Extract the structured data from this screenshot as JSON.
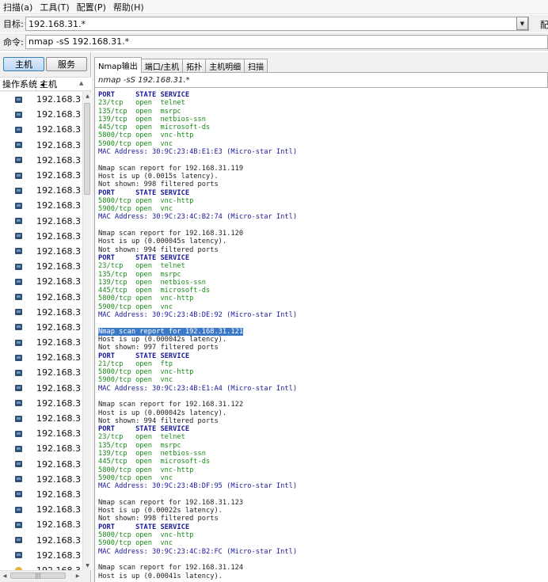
{
  "menu": [
    "扫描(a)",
    "工具(T)",
    "配置(P)",
    "帮助(H)"
  ],
  "target": {
    "label": "目标:",
    "value": "192.168.31.*",
    "profile_label": "配"
  },
  "command": {
    "label": "命令:",
    "value": "nmap -sS 192.168.31.*"
  },
  "left_panel": {
    "hosts_button": "主机",
    "services_button": "服务",
    "col_os": "操作系统 ◂",
    "col_host": "主机",
    "hosts": [
      {
        "ip": "192.168.3",
        "os": "windows"
      },
      {
        "ip": "192.168.3",
        "os": "windows"
      },
      {
        "ip": "192.168.3",
        "os": "windows"
      },
      {
        "ip": "192.168.3",
        "os": "windows"
      },
      {
        "ip": "192.168.3",
        "os": "windows"
      },
      {
        "ip": "192.168.3",
        "os": "windows"
      },
      {
        "ip": "192.168.3",
        "os": "windows"
      },
      {
        "ip": "192.168.3",
        "os": "windows"
      },
      {
        "ip": "192.168.3",
        "os": "windows"
      },
      {
        "ip": "192.168.3",
        "os": "windows"
      },
      {
        "ip": "192.168.3",
        "os": "windows"
      },
      {
        "ip": "192.168.3",
        "os": "windows"
      },
      {
        "ip": "192.168.3",
        "os": "windows"
      },
      {
        "ip": "192.168.3",
        "os": "windows"
      },
      {
        "ip": "192.168.3",
        "os": "windows"
      },
      {
        "ip": "192.168.3",
        "os": "windows"
      },
      {
        "ip": "192.168.3",
        "os": "windows"
      },
      {
        "ip": "192.168.3",
        "os": "windows"
      },
      {
        "ip": "192.168.3",
        "os": "windows"
      },
      {
        "ip": "192.168.3",
        "os": "windows"
      },
      {
        "ip": "192.168.3",
        "os": "windows"
      },
      {
        "ip": "192.168.3",
        "os": "windows"
      },
      {
        "ip": "192.168.3",
        "os": "windows"
      },
      {
        "ip": "192.168.3",
        "os": "windows"
      },
      {
        "ip": "192.168.3",
        "os": "windows"
      },
      {
        "ip": "192.168.3",
        "os": "windows"
      },
      {
        "ip": "192.168.3",
        "os": "windows"
      },
      {
        "ip": "192.168.3",
        "os": "windows"
      },
      {
        "ip": "192.168.3",
        "os": "windows"
      },
      {
        "ip": "192.168.3",
        "os": "windows"
      },
      {
        "ip": "192.168.3",
        "os": "windows"
      },
      {
        "ip": "192.168.3",
        "os": "linux"
      },
      {
        "ip": "192.168.3",
        "os": "windows"
      }
    ]
  },
  "tabs": [
    "Nmap输出",
    "端口/主机",
    "拓扑",
    "主机明细",
    "扫描"
  ],
  "output_command": "nmap -sS 192.168.31.*",
  "output": [
    {
      "t": "PORT     STATE SERVICE",
      "c": "hdr"
    },
    {
      "t": "23/tcp   open  telnet",
      "c": "open"
    },
    {
      "t": "135/tcp  open  msrpc",
      "c": "open"
    },
    {
      "t": "139/tcp  open  netbios-ssn",
      "c": "open"
    },
    {
      "t": "445/tcp  open  microsoft-ds",
      "c": "open"
    },
    {
      "t": "5800/tcp open  vnc-http",
      "c": "open"
    },
    {
      "t": "5900/tcp open  vnc",
      "c": "open"
    },
    {
      "t": "MAC Address: 30:9C:23:4B:E1:E3 (Micro-star Intl)",
      "c": "mac"
    },
    {
      "t": "",
      "c": "blank"
    },
    {
      "t": "Nmap scan report for 192.168.31.119",
      "c": "plain"
    },
    {
      "t": "Host is up (0.0015s latency).",
      "c": "plain"
    },
    {
      "t": "Not shown: 998 filtered ports",
      "c": "plain"
    },
    {
      "t": "PORT     STATE SERVICE",
      "c": "hdr"
    },
    {
      "t": "5800/tcp open  vnc-http",
      "c": "open"
    },
    {
      "t": "5900/tcp open  vnc",
      "c": "open"
    },
    {
      "t": "MAC Address: 30:9C:23:4C:B2:74 (Micro-star Intl)",
      "c": "mac"
    },
    {
      "t": "",
      "c": "blank"
    },
    {
      "t": "Nmap scan report for 192.168.31.120",
      "c": "plain"
    },
    {
      "t": "Host is up (0.000045s latency).",
      "c": "plain"
    },
    {
      "t": "Not shown: 994 filtered ports",
      "c": "plain"
    },
    {
      "t": "PORT     STATE SERVICE",
      "c": "hdr"
    },
    {
      "t": "23/tcp   open  telnet",
      "c": "open"
    },
    {
      "t": "135/tcp  open  msrpc",
      "c": "open"
    },
    {
      "t": "139/tcp  open  netbios-ssn",
      "c": "open"
    },
    {
      "t": "445/tcp  open  microsoft-ds",
      "c": "open"
    },
    {
      "t": "5800/tcp open  vnc-http",
      "c": "open"
    },
    {
      "t": "5900/tcp open  vnc",
      "c": "open"
    },
    {
      "t": "MAC Address: 30:9C:23:4B:DE:92 (Micro-star Intl)",
      "c": "mac"
    },
    {
      "t": "",
      "c": "blank"
    },
    {
      "t": "Nmap scan report for 192.168.31.121",
      "c": "hl"
    },
    {
      "t": "Host is up (0.000042s latency).",
      "c": "plain"
    },
    {
      "t": "Not shown: 997 filtered ports",
      "c": "plain"
    },
    {
      "t": "PORT     STATE SERVICE",
      "c": "hdr"
    },
    {
      "t": "21/tcp   open  ftp",
      "c": "open"
    },
    {
      "t": "5800/tcp open  vnc-http",
      "c": "open"
    },
    {
      "t": "5900/tcp open  vnc",
      "c": "open"
    },
    {
      "t": "MAC Address: 30:9C:23:4B:E1:A4 (Micro-star Intl)",
      "c": "mac"
    },
    {
      "t": "",
      "c": "blank"
    },
    {
      "t": "Nmap scan report for 192.168.31.122",
      "c": "plain"
    },
    {
      "t": "Host is up (0.000042s latency).",
      "c": "plain"
    },
    {
      "t": "Not shown: 994 filtered ports",
      "c": "plain"
    },
    {
      "t": "PORT     STATE SERVICE",
      "c": "hdr"
    },
    {
      "t": "23/tcp   open  telnet",
      "c": "open"
    },
    {
      "t": "135/tcp  open  msrpc",
      "c": "open"
    },
    {
      "t": "139/tcp  open  netbios-ssn",
      "c": "open"
    },
    {
      "t": "445/tcp  open  microsoft-ds",
      "c": "open"
    },
    {
      "t": "5800/tcp open  vnc-http",
      "c": "open"
    },
    {
      "t": "5900/tcp open  vnc",
      "c": "open"
    },
    {
      "t": "MAC Address: 30:9C:23:4B:DF:95 (Micro-star Intl)",
      "c": "mac"
    },
    {
      "t": "",
      "c": "blank"
    },
    {
      "t": "Nmap scan report for 192.168.31.123",
      "c": "plain"
    },
    {
      "t": "Host is up (0.00022s latency).",
      "c": "plain"
    },
    {
      "t": "Not shown: 998 filtered ports",
      "c": "plain"
    },
    {
      "t": "PORT     STATE SERVICE",
      "c": "hdr"
    },
    {
      "t": "5800/tcp open  vnc-http",
      "c": "open"
    },
    {
      "t": "5900/tcp open  vnc",
      "c": "open"
    },
    {
      "t": "MAC Address: 30:9C:23:4C:B2:FC (Micro-star Intl)",
      "c": "mac"
    },
    {
      "t": "",
      "c": "blank"
    },
    {
      "t": "Nmap scan report for 192.168.31.124",
      "c": "plain"
    },
    {
      "t": "Host is up (0.00041s latency).",
      "c": "plain"
    }
  ],
  "colors": {
    "header": "#1a1a9a",
    "open": "#1a8a1a",
    "highlight": "#3c78c8"
  }
}
